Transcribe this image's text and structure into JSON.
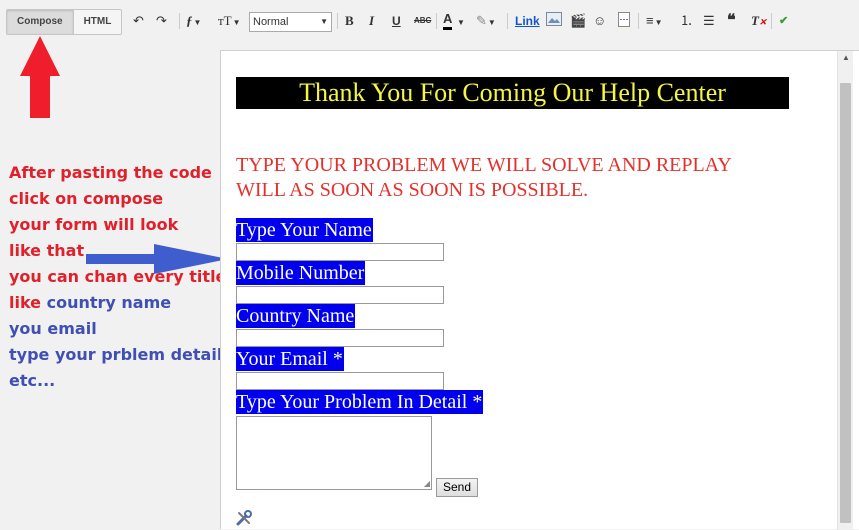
{
  "toolbar": {
    "compose_label": "Compose",
    "html_label": "HTML",
    "font_select_value": "Normal",
    "link_label": "Link",
    "icons": [
      "undo-icon",
      "redo-icon",
      "font-family-icon",
      "font-size-icon",
      "bold-icon",
      "italic-icon",
      "underline-icon",
      "strikethrough-icon",
      "text-color-icon",
      "highlight-icon",
      "link-icon",
      "image-icon",
      "video-icon",
      "emoji-icon",
      "jump-break-icon",
      "align-icon",
      "numbered-list-icon",
      "bulleted-list-icon",
      "quote-icon",
      "clear-format-icon",
      "spellcheck-icon"
    ]
  },
  "annotation": {
    "lines": [
      {
        "text": "After pasting the code",
        "color": "red"
      },
      {
        "text": "click on compose",
        "color": "red"
      },
      {
        "text": "your form will look",
        "color": "red"
      },
      {
        "text": "like that",
        "color": "red"
      },
      {
        "text": "you can chan every title",
        "color": "red"
      }
    ],
    "like_word": "like",
    "like_rest": " country name",
    "blue_lines": [
      "you email",
      "type your prblem detail",
      "etc..."
    ],
    "colors": {
      "red": "#e0202b",
      "blue": "#3f4fb3"
    }
  },
  "editor": {
    "title": "Thank You For Coming Our Help Center",
    "intro_line1": "TYPE YOUR PROBLEM WE WILL SOLVE AND REPLAY",
    "intro_line2": "WILL AS SOON AS SOON IS POSSIBLE.",
    "fields": [
      {
        "label": "Type Your Name"
      },
      {
        "label": "Mobile Number"
      },
      {
        "label": "Country Name"
      },
      {
        "label": "Your Email *"
      },
      {
        "label": "Type Your Problem In Detail *"
      }
    ],
    "send_label": "Send",
    "colors": {
      "title_bg": "#000000",
      "title_fg": "#f5f542",
      "intro": "#e4312b",
      "label_bg": "#0000ee"
    }
  }
}
